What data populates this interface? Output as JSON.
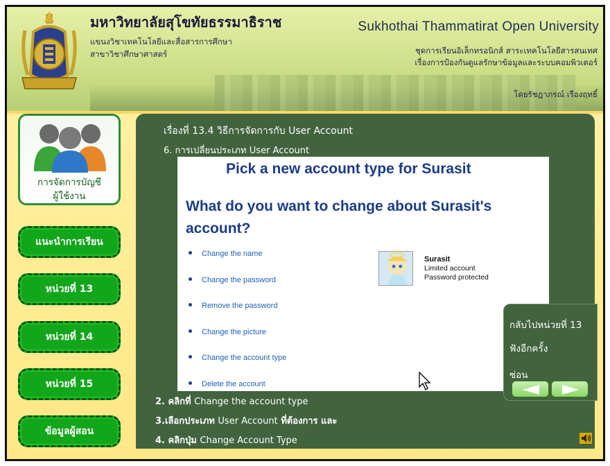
{
  "header": {
    "title_th": "มหาวิทยาลัยสุโขทัยธรรมาธิราช",
    "sub_th_1": "แขนงวิชาเทคโนโลยีและสื่อสารการศึกษา",
    "sub_th_2": "สาขาวิชาศึกษาศาสตร์",
    "title_en": "Sukhothai Thammatirat Open University",
    "right_1": "ชุดการเรียนอิเล็กทรอนิกส์ สาระเทคโนโลยีสารสนเทศ",
    "right_2": "เรื่องการป้องกันดูแลรักษาข้อมูลและระบบคอมพิวเตอร์",
    "author": "โดยรัชฎาภรณ์ เรืองฤทธิ์"
  },
  "sidebar": {
    "user_label_1": "การจัดการบัญชี",
    "user_label_2": "ผู้ใช้งาน",
    "items": [
      {
        "label": "แนะนำการเรียน"
      },
      {
        "label": "หน่วยที่ 13"
      },
      {
        "label": "หน่วยที่ 14"
      },
      {
        "label": "หน่วยที่ 15"
      },
      {
        "label": "ข้อมูลผู้สอน"
      }
    ]
  },
  "content": {
    "topic": "เรื่องที่ 13.4 วิธีการจัดการกับ User Account",
    "subtopic": "6. การเปลี่ยนประเภท User Account"
  },
  "screenshot": {
    "pick_title": "Pick a new account type for Surasit",
    "question": "What do you want to change about Surasit's account?",
    "links": [
      "Change the name",
      "Change the password",
      "Remove the password",
      "Change the picture",
      "Change the account type",
      "Delete the account"
    ],
    "user_name": "Surasit",
    "user_type": "Limited account",
    "user_pw": "Password protected"
  },
  "steps": [
    {
      "prefix": "2. คลิกที่",
      "en": "Change the account type",
      "suffix": ""
    },
    {
      "prefix": "3.เลือกประเภท",
      "en": "User Account",
      "suffix": "ที่ต้องการ และ"
    },
    {
      "prefix": "4. คลิกปุ่ม",
      "en": "Change Account Type",
      "suffix": ""
    }
  ],
  "side_panel": {
    "back": "กลับไปหน่วยที่ 13",
    "replay": "ฟังอีกครั้ง",
    "hide": "ซ่อน"
  },
  "colors": {
    "nav_green": "#12a61a",
    "panel_green": "#41633e",
    "body_yellow": "#ffe786",
    "header_green": "#cfe08a",
    "link_blue": "#1a5fc0",
    "heading_blue": "#1b3b8a"
  },
  "icons": [
    "university-seal-icon",
    "users-group-icon",
    "mouse-cursor-icon",
    "arrow-left-icon",
    "arrow-right-icon",
    "speaker-icon"
  ]
}
